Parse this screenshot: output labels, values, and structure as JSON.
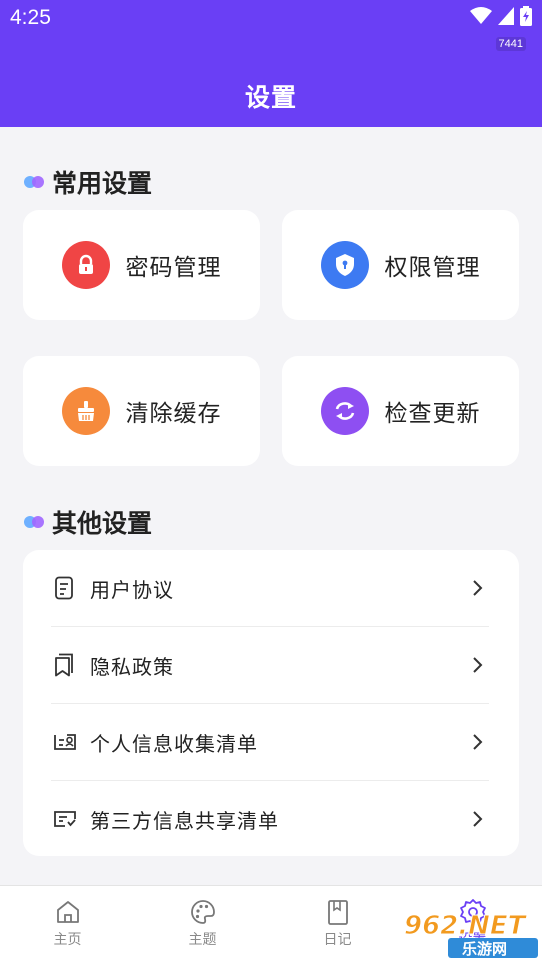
{
  "status_bar": {
    "time": "4:25",
    "badge": "7441"
  },
  "header": {
    "title": "设置"
  },
  "sections": {
    "common": {
      "title": "常用设置"
    },
    "other": {
      "title": "其他设置"
    }
  },
  "common_items": [
    {
      "label": "密码管理",
      "icon": "lock-icon",
      "color": "#f04545"
    },
    {
      "label": "权限管理",
      "icon": "shield-icon",
      "color": "#3d7af2"
    },
    {
      "label": "清除缓存",
      "icon": "broom-icon",
      "color": "#f68a3c"
    },
    {
      "label": "检查更新",
      "icon": "refresh-icon",
      "color": "#8e4ff2"
    }
  ],
  "other_items": [
    {
      "label": "用户协议",
      "icon": "document-icon"
    },
    {
      "label": "隐私政策",
      "icon": "bookmark-doc-icon"
    },
    {
      "label": "个人信息收集清单",
      "icon": "id-card-icon"
    },
    {
      "label": "第三方信息共享清单",
      "icon": "share-card-icon"
    }
  ],
  "tabbar": [
    {
      "label": "主页",
      "icon": "home-icon"
    },
    {
      "label": "主题",
      "icon": "palette-icon"
    },
    {
      "label": "日记",
      "icon": "diary-icon"
    },
    {
      "label": "设置",
      "icon": "settings-icon",
      "active": true
    }
  ],
  "watermark": {
    "text": "962.NET",
    "subtext": "乐游网"
  },
  "colors": {
    "accent": "#6a3ff5",
    "background": "#f4f4f7"
  }
}
